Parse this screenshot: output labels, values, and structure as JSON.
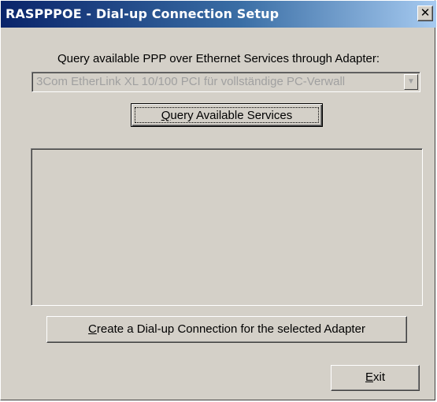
{
  "window": {
    "title": "RASPPPOE - Dial-up Connection Setup",
    "close_glyph": "✕"
  },
  "prompt_label": "Query available PPP over Ethernet Services through Adapter:",
  "adapter_select": {
    "selected_value": "3Com EtherLink XL 10/100 PCI für vollständige PC-Verwall",
    "enabled": false,
    "arrow_icon": "chevron-down-icon"
  },
  "buttons": {
    "query_accel": "Q",
    "query_rest": "uery Available Services",
    "create_accel": "C",
    "create_rest": "reate a Dial-up Connection for the selected Adapter",
    "exit_accel": "E",
    "exit_rest": "xit"
  },
  "services_list": {
    "items": []
  },
  "colors": {
    "face": "#d4d0c8",
    "title_start": "#0a246a",
    "title_end": "#a6caf0",
    "disabled_text": "#a0a0a0"
  }
}
